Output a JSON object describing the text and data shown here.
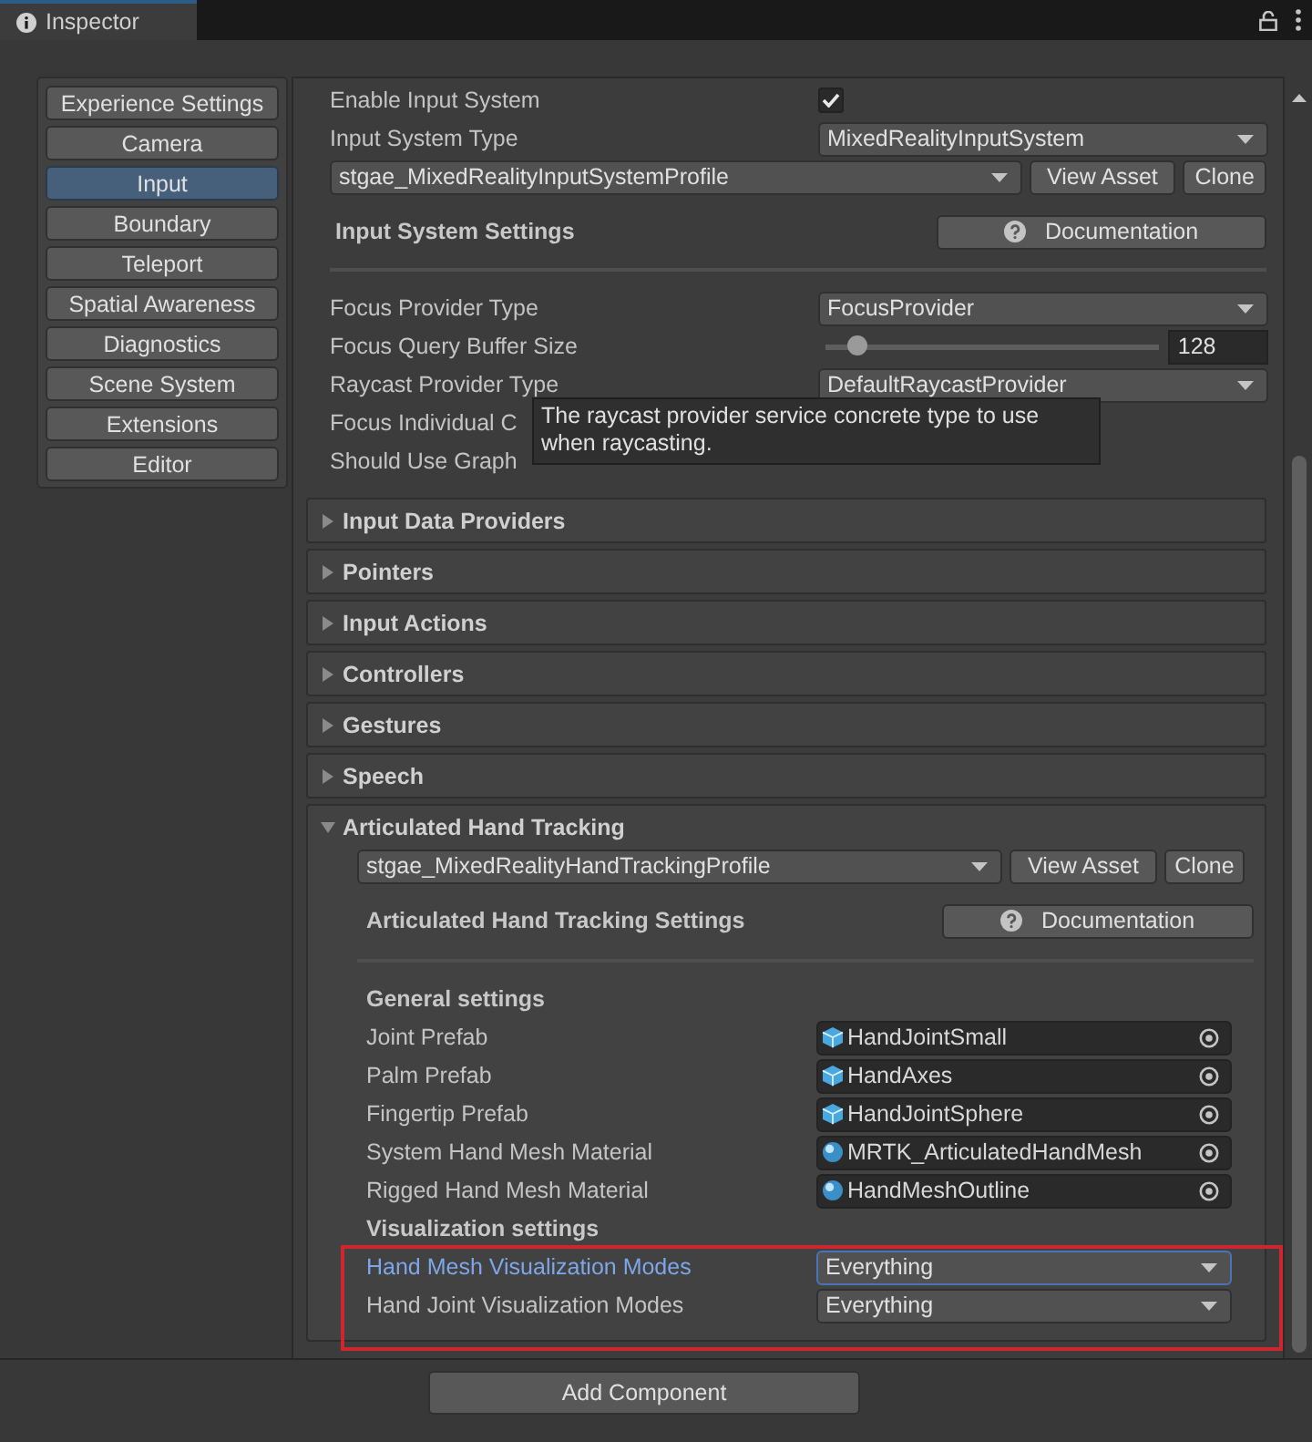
{
  "window": {
    "title": "Inspector"
  },
  "nav": {
    "items": [
      {
        "label": "Experience Settings",
        "selected": false
      },
      {
        "label": "Camera",
        "selected": false
      },
      {
        "label": "Input",
        "selected": true
      },
      {
        "label": "Boundary",
        "selected": false
      },
      {
        "label": "Teleport",
        "selected": false
      },
      {
        "label": "Spatial Awareness",
        "selected": false
      },
      {
        "label": "Diagnostics",
        "selected": false
      },
      {
        "label": "Scene System",
        "selected": false
      },
      {
        "label": "Extensions",
        "selected": false
      },
      {
        "label": "Editor",
        "selected": false
      }
    ]
  },
  "input_system": {
    "enable_label": "Enable Input System",
    "enabled": true,
    "type_label": "Input System Type",
    "type_value": "MixedRealityInputSystem",
    "profile": "stgae_MixedRealityInputSystemProfile",
    "view_asset": "View Asset",
    "clone": "Clone",
    "settings_title": "Input System Settings",
    "documentation": "Documentation",
    "fields": [
      {
        "kind": "dropdown",
        "label": "Focus Provider Type",
        "value": "FocusProvider"
      },
      {
        "kind": "slider",
        "label": "Focus Query Buffer Size",
        "level": 0.09,
        "value": "128"
      },
      {
        "kind": "dropdown",
        "label": "Raycast Provider Type",
        "value": "DefaultRaycastProvider"
      },
      {
        "kind": "label",
        "label": "Focus Individual C"
      },
      {
        "kind": "label",
        "label": "Should Use Graph"
      }
    ],
    "tooltip": "The raycast provider service concrete type to use when raycasting."
  },
  "sections": [
    {
      "title": "Input Data Providers",
      "expanded": false
    },
    {
      "title": "Pointers",
      "expanded": false
    },
    {
      "title": "Input Actions",
      "expanded": false
    },
    {
      "title": "Controllers",
      "expanded": false
    },
    {
      "title": "Gestures",
      "expanded": false
    },
    {
      "title": "Speech",
      "expanded": false
    },
    {
      "title": "Articulated Hand Tracking",
      "expanded": true,
      "body": {
        "profile": "stgae_MixedRealityHandTrackingProfile",
        "view_asset": "View Asset",
        "clone": "Clone",
        "settings_title": "Articulated Hand Tracking Settings",
        "documentation": "Documentation",
        "general_title": "General settings",
        "object_fields": [
          {
            "label": "Joint Prefab",
            "kind": "prefab",
            "value": "HandJointSmall"
          },
          {
            "label": "Palm Prefab",
            "kind": "prefab",
            "value": "HandAxes"
          },
          {
            "label": "Fingertip Prefab",
            "kind": "prefab",
            "value": "HandJointSphere"
          },
          {
            "label": "System Hand Mesh Material",
            "kind": "material",
            "value": "MRTK_ArticulatedHandMesh"
          },
          {
            "label": "Rigged Hand Mesh Material",
            "kind": "material",
            "value": "HandMeshOutline"
          }
        ],
        "visualization_title": "Visualization settings",
        "highlighted": true,
        "modes": [
          {
            "label": "Hand Mesh Visualization Modes",
            "value": "Everything",
            "focused": true
          },
          {
            "label": "Hand Joint Visualization Modes",
            "value": "Everything",
            "focused": false
          }
        ]
      }
    }
  ],
  "footer": {
    "add_component": "Add Component"
  }
}
